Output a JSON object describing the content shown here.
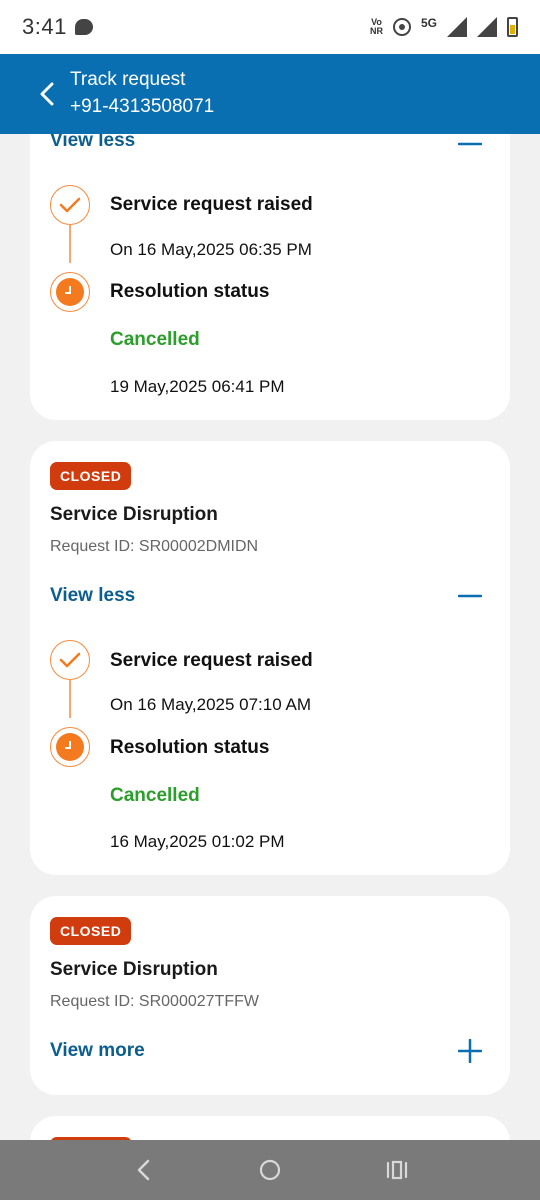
{
  "status_bar": {
    "time": "3:41",
    "volte_top": "Vo",
    "volte_bottom": "NR",
    "network": "5G"
  },
  "app_bar": {
    "title": "Track request",
    "subtitle": "+91-4313508071"
  },
  "cards": [
    {
      "toggle_label": "View less",
      "steps": [
        {
          "title": "Service request raised",
          "date": "On 16 May,2025 06:35 PM"
        },
        {
          "title": "Resolution status",
          "status": "Cancelled",
          "date": "19 May,2025 06:41 PM"
        }
      ]
    },
    {
      "badge": "CLOSED",
      "title": "Service Disruption",
      "request_id": "Request ID: SR00002DMIDN",
      "toggle_label": "View less",
      "steps": [
        {
          "title": "Service request raised",
          "date": "On 16 May,2025 07:10 AM"
        },
        {
          "title": "Resolution status",
          "status": "Cancelled",
          "date": "16 May,2025 01:02 PM"
        }
      ]
    },
    {
      "badge": "CLOSED",
      "title": "Service Disruption",
      "request_id": "Request ID: SR000027TFFW",
      "toggle_label": "View more"
    }
  ],
  "colors": {
    "app_bar": "#0a6fb0",
    "badge": "#d13c0f",
    "link": "#0b5e8e",
    "timeline": "#f47a20",
    "cancelled": "#2b9e2b"
  },
  "icons": {
    "back": "chevron-left-icon",
    "collapse": "minus-icon",
    "expand": "plus-icon",
    "step_done": "check-icon",
    "step_pending": "clock-icon"
  }
}
